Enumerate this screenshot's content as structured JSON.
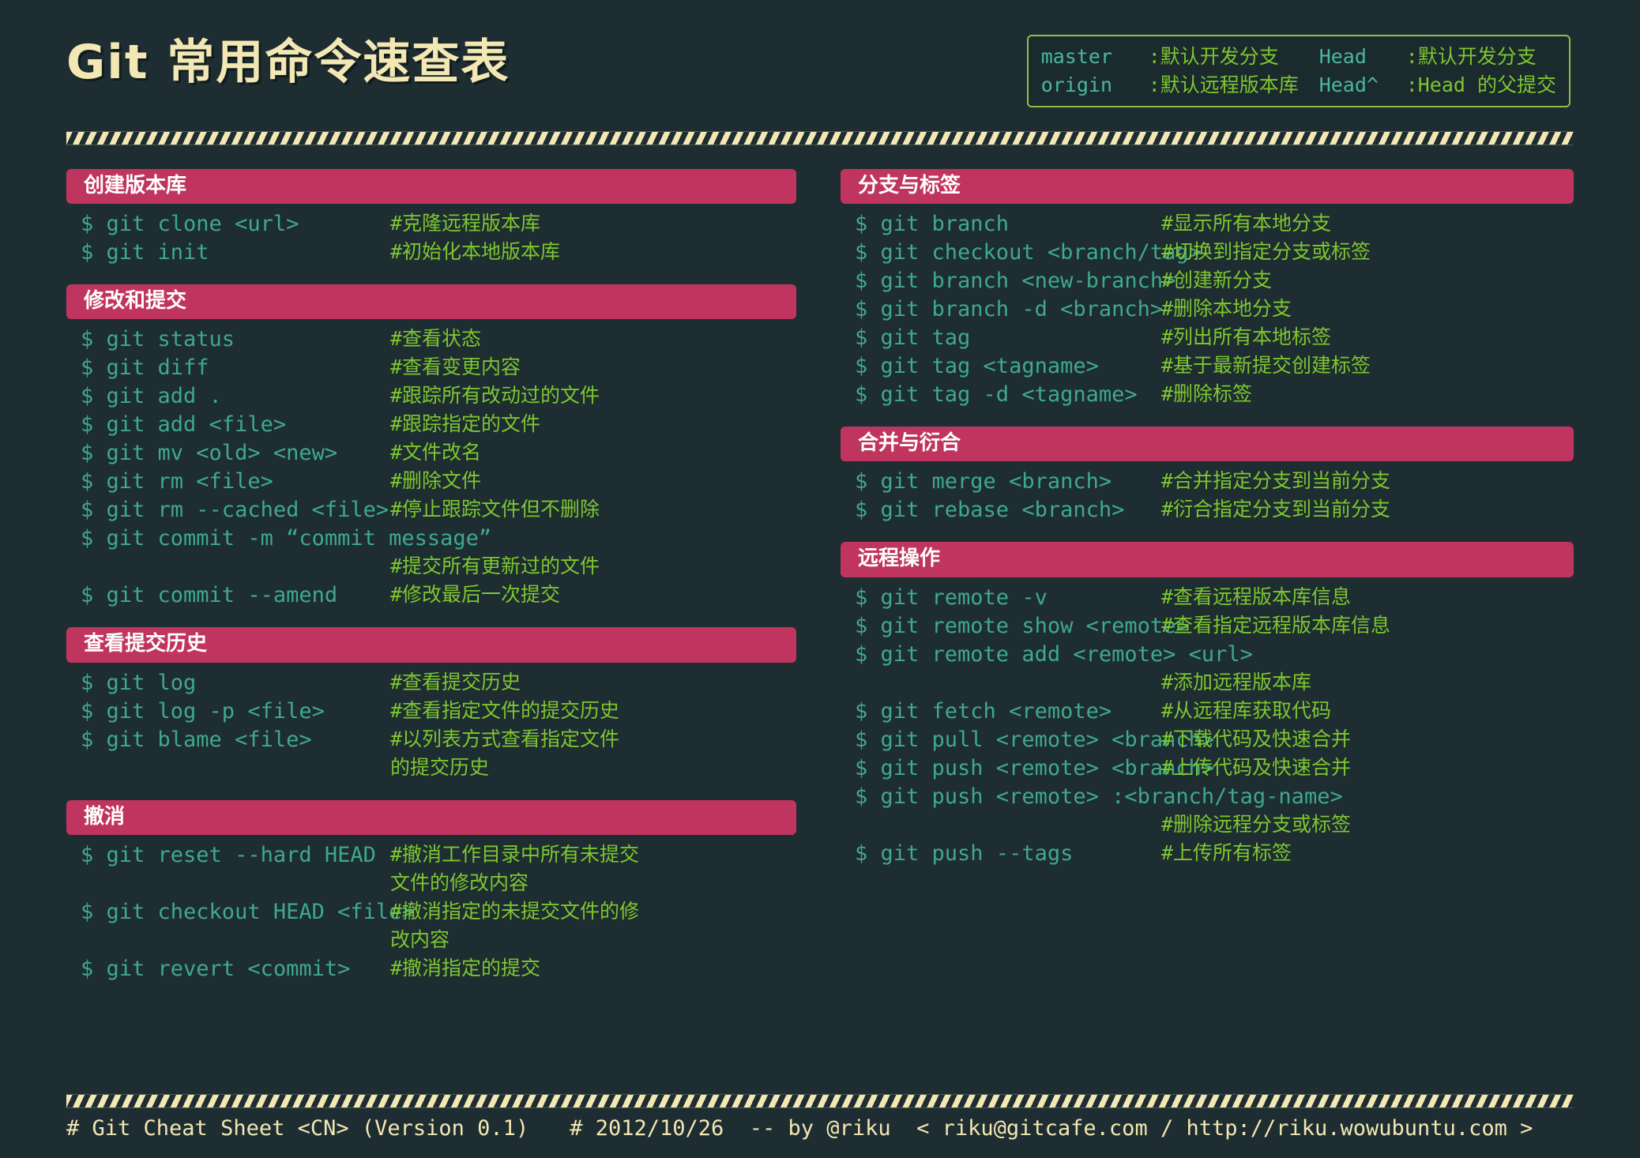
{
  "title": "Git 常用命令速查表",
  "legend": {
    "rows": [
      {
        "term1": "master",
        "desc1": ":默认开发分支",
        "term2": "Head",
        "desc2": ":默认开发分支"
      },
      {
        "term1": "origin",
        "desc1": ":默认远程版本库",
        "term2": "Head^",
        "desc2": ":Head 的父提交"
      }
    ]
  },
  "colors": {
    "background": "#1d2d31",
    "title": "#f3e7b4",
    "section_header_bg": "#c0355f",
    "section_header_text": "#ffffff",
    "command": "#3fa98c",
    "comment": "#7ec62f",
    "legend_border": "#8fbf4a",
    "stripe": "#f3e7b4"
  },
  "left_sections": [
    {
      "title": "创建版本库",
      "rows": [
        {
          "cmd": "$ git clone <url>",
          "comment": "#克隆远程版本库"
        },
        {
          "cmd": "$ git init",
          "comment": "#初始化本地版本库"
        }
      ]
    },
    {
      "title": "修改和提交",
      "rows": [
        {
          "cmd": "$ git status",
          "comment": "#查看状态"
        },
        {
          "cmd": "$ git diff",
          "comment": "#查看变更内容"
        },
        {
          "cmd": "$ git add .",
          "comment": "#跟踪所有改动过的文件"
        },
        {
          "cmd": "$ git add <file>",
          "comment": "#跟踪指定的文件"
        },
        {
          "cmd": "$ git mv <old> <new>",
          "comment": "#文件改名"
        },
        {
          "cmd": "$ git rm <file>",
          "comment": "#删除文件"
        },
        {
          "cmd": "$ git rm --cached <file>",
          "comment": "#停止跟踪文件但不删除"
        },
        {
          "cmd": "$ git commit -m “commit message”",
          "comment": ""
        },
        {
          "cmd": "",
          "comment": "#提交所有更新过的文件"
        },
        {
          "cmd": "$ git commit --amend",
          "comment": "#修改最后一次提交"
        }
      ]
    },
    {
      "title": "查看提交历史",
      "rows": [
        {
          "cmd": "$ git log",
          "comment": "#查看提交历史"
        },
        {
          "cmd": "$ git log -p <file>",
          "comment": "#查看指定文件的提交历史"
        },
        {
          "cmd": "$ git blame <file>",
          "comment": "#以列表方式查看指定文件"
        },
        {
          "cmd": "",
          "comment": "的提交历史"
        }
      ]
    },
    {
      "title": "撤消",
      "rows": [
        {
          "cmd": "$ git reset --hard HEAD",
          "comment": "#撤消工作目录中所有未提交"
        },
        {
          "cmd": "",
          "comment": "文件的修改内容"
        },
        {
          "cmd": "$ git checkout HEAD <file>",
          "comment": "#撤消指定的未提交文件的修"
        },
        {
          "cmd": "",
          "comment": "改内容"
        },
        {
          "cmd": "$ git revert <commit>",
          "comment": "#撤消指定的提交"
        }
      ]
    }
  ],
  "right_sections": [
    {
      "title": "分支与标签",
      "rows": [
        {
          "cmd": "$ git branch",
          "comment": "#显示所有本地分支"
        },
        {
          "cmd": "$ git checkout <branch/tag>",
          "comment": "#切换到指定分支或标签"
        },
        {
          "cmd": "$ git branch <new-branch>",
          "comment": "#创建新分支"
        },
        {
          "cmd": "$ git branch -d <branch>",
          "comment": "#删除本地分支"
        },
        {
          "cmd": "$ git tag",
          "comment": "#列出所有本地标签"
        },
        {
          "cmd": "$ git tag <tagname>",
          "comment": "#基于最新提交创建标签"
        },
        {
          "cmd": "$ git tag -d <tagname>",
          "comment": "#删除标签"
        }
      ]
    },
    {
      "title": "合并与衍合",
      "rows": [
        {
          "cmd": "$ git merge <branch>",
          "comment": "#合并指定分支到当前分支"
        },
        {
          "cmd": "$ git rebase <branch>",
          "comment": "#衍合指定分支到当前分支"
        }
      ]
    },
    {
      "title": "远程操作",
      "rows": [
        {
          "cmd": "$ git remote -v",
          "comment": "#查看远程版本库信息"
        },
        {
          "cmd": "$ git remote show <remote>",
          "comment": "#查看指定远程版本库信息"
        },
        {
          "cmd": "$ git remote add <remote> <url>",
          "comment": ""
        },
        {
          "cmd": "",
          "comment": "#添加远程版本库"
        },
        {
          "cmd": "$ git fetch <remote>",
          "comment": "#从远程库获取代码"
        },
        {
          "cmd": "$ git pull <remote> <branch>",
          "comment": "#下载代码及快速合并"
        },
        {
          "cmd": "$ git push <remote> <branch>",
          "comment": "#上传代码及快速合并"
        },
        {
          "cmd": "$ git push <remote> :<branch/tag-name>",
          "comment": ""
        },
        {
          "cmd": "",
          "comment": "#删除远程分支或标签"
        },
        {
          "cmd": "$ git push --tags",
          "comment": "#上传所有标签"
        }
      ]
    }
  ],
  "footer": {
    "left": "# Git Cheat Sheet <CN> (Version 0.1)",
    "right": "# 2012/10/26  -- by @riku  < riku@gitcafe.com / http://riku.wowubuntu.com >"
  }
}
